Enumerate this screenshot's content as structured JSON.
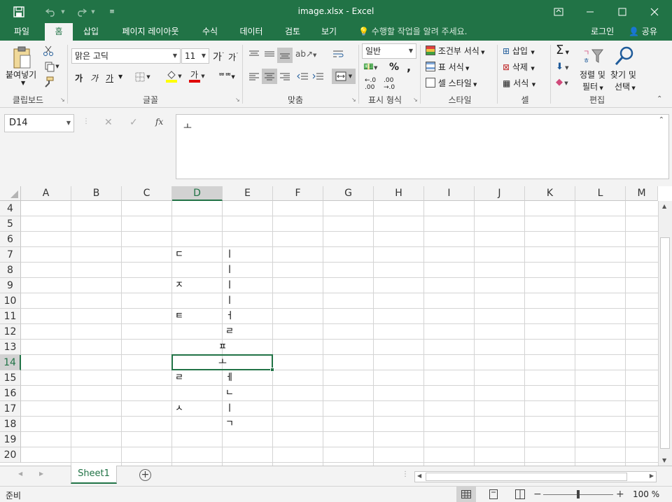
{
  "window": {
    "title": "image.xlsx - Excel"
  },
  "tabs": {
    "items": [
      "파일",
      "홈",
      "삽입",
      "페이지 레이아웃",
      "수식",
      "데이터",
      "검토",
      "보기"
    ],
    "active": "홈",
    "tell_me": "수행할 작업을 알려 주세요.",
    "login": "로그인",
    "share": "공유"
  },
  "ribbon": {
    "clipboard": {
      "label": "클립보드",
      "paste": "붙여넣기"
    },
    "font": {
      "label": "글꼴",
      "font_name": "맑은 고딕",
      "font_size": "11",
      "bold": "가",
      "italic": "가",
      "underline": "가"
    },
    "alignment": {
      "label": "맞춤"
    },
    "number": {
      "label": "표시 형식",
      "format": "일반"
    },
    "styles": {
      "label": "스타일",
      "conditional": "조건부 서식",
      "table": "표 서식",
      "cell_styles": "셀 스타일"
    },
    "cells": {
      "label": "셀",
      "insert": "삽입",
      "delete": "삭제",
      "format": "서식"
    },
    "editing": {
      "label": "편집",
      "sort_filter_1": "정렬 및",
      "sort_filter_2": "필터",
      "find_select_1": "찾기 및",
      "find_select_2": "선택"
    }
  },
  "formula_bar": {
    "name_box": "D14",
    "content": "ㅗ",
    "fx": "fx"
  },
  "grid": {
    "columns": [
      "A",
      "B",
      "C",
      "D",
      "E",
      "F",
      "G",
      "H",
      "I",
      "J",
      "K",
      "L",
      "M"
    ],
    "rows": [
      "4",
      "5",
      "6",
      "7",
      "8",
      "9",
      "10",
      "11",
      "12",
      "13",
      "14",
      "15",
      "16",
      "17",
      "18",
      "19",
      "20"
    ],
    "selected_cell": "D14",
    "cells": [
      {
        "ref": "D7",
        "value": "ㄷ"
      },
      {
        "ref": "E7",
        "value": "ㅣ"
      },
      {
        "ref": "E8",
        "value": "ㅣ"
      },
      {
        "ref": "D9",
        "value": "ㅈ"
      },
      {
        "ref": "E9",
        "value": "ㅣ"
      },
      {
        "ref": "E10",
        "value": "ㅣ"
      },
      {
        "ref": "D11",
        "value": "ㅌ"
      },
      {
        "ref": "E11",
        "value": "ㅓ"
      },
      {
        "ref": "E12",
        "value": "ㄹ"
      },
      {
        "ref": "D13",
        "value": "ㅍ"
      },
      {
        "ref": "D14",
        "value": "ㅗ"
      },
      {
        "ref": "D15",
        "value": "ㄹ"
      },
      {
        "ref": "E15",
        "value": "ㅔ"
      },
      {
        "ref": "E16",
        "value": "ㄴ"
      },
      {
        "ref": "D17",
        "value": "ㅅ"
      },
      {
        "ref": "E17",
        "value": "ㅣ"
      },
      {
        "ref": "E18",
        "value": "ㄱ"
      }
    ]
  },
  "sheets": {
    "tabs": [
      "Sheet1"
    ],
    "active": "Sheet1"
  },
  "status": {
    "ready": "준비",
    "zoom": "100 %"
  },
  "colors": {
    "excel_green": "#217346",
    "ribbon_bg": "#f3f3f3",
    "gridline": "#d4d4d4"
  }
}
